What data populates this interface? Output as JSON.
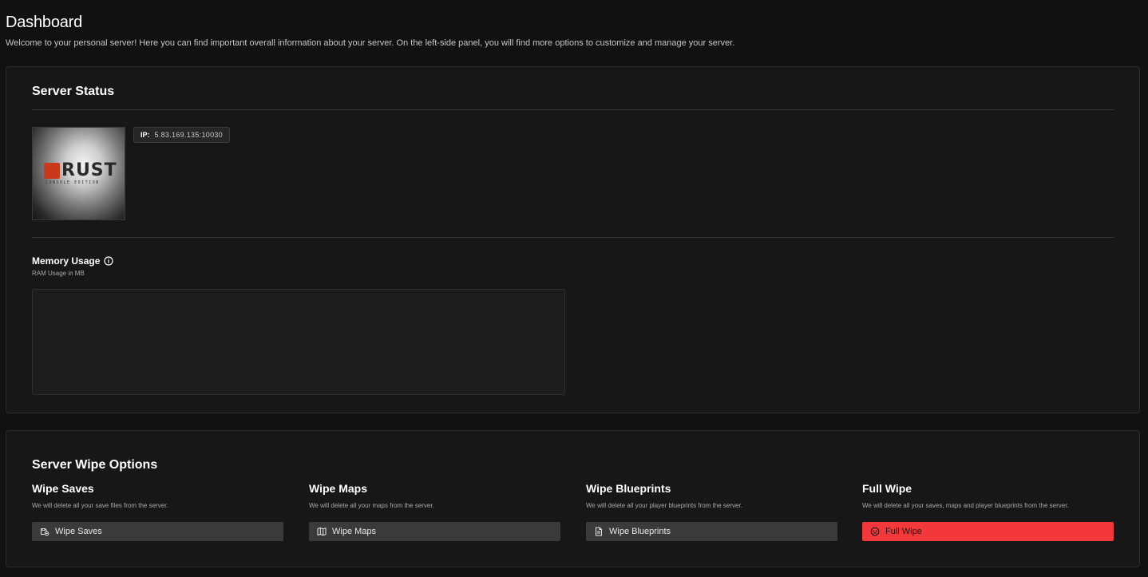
{
  "header": {
    "title": "Dashboard",
    "subtitle": "Welcome to your personal server! Here you can find important overall information about your server. On the left-side panel, you will find more options to customize and manage your server."
  },
  "server_status": {
    "title": "Server Status",
    "image": {
      "logo_text": "RUST",
      "logo_sub": "CONSOLE EDITION"
    },
    "ip_label": "IP:",
    "ip_value": "5.83.169.135:10030",
    "memory": {
      "title": "Memory Usage",
      "subtitle": "RAM Usage in MB",
      "icon": "info-icon"
    }
  },
  "wipe_options": {
    "title": "Server Wipe Options",
    "items": [
      {
        "heading": "Wipe Saves",
        "description": "We will delete all your save files from the server.",
        "button_label": "Wipe Saves",
        "icon": "save-icon"
      },
      {
        "heading": "Wipe Maps",
        "description": "We will delete all your maps from the server.",
        "button_label": "Wipe Maps",
        "icon": "map-icon"
      },
      {
        "heading": "Wipe Blueprints",
        "description": "We will delete all your player blueprints from the server.",
        "button_label": "Wipe Blueprints",
        "icon": "document-icon"
      },
      {
        "heading": "Full Wipe",
        "description": "We will delete all your saves, maps and player blueprints from the server.",
        "button_label": "Full Wipe",
        "icon": "skull-icon"
      }
    ]
  },
  "colors": {
    "background": "#111111",
    "card": "#171717",
    "button": "#3a3a3a",
    "danger": "#f2383a",
    "rust_logo": "#c9391a"
  }
}
